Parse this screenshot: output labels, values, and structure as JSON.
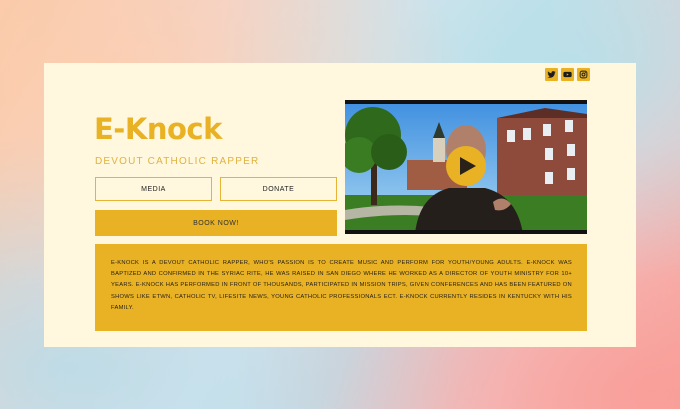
{
  "site": {
    "title": "E-Knock",
    "subtitle": "DEVOUT CATHOLIC RAPPER"
  },
  "social": {
    "icons": [
      "twitter-icon",
      "youtube-icon",
      "instagram-icon"
    ]
  },
  "buttons": {
    "media": "MEDIA",
    "donate": "DONATE",
    "book": "BOOK NOW!"
  },
  "bio": {
    "text": "E-KNOCK IS A DEVOUT CATHOLIC RAPPER, WHO'S PASSION IS TO CREATE MUSIC AND PERFORM FOR YOUTH/YOUNG ADULTS. E-KNOCK WAS BAPTIZED AND CONFIRMED IN THE SYRIAC RITE, HE WAS RAISED IN SAN DIEGO WHERE HE WORKED AS A DIRECTOR OF YOUTH MINISTRY FOR 10+ YEARS. E-KNOCK HAS PERFORMED IN FRONT OF THOUSANDS, PARTICIPATED IN MISSION TRIPS, GIVEN CONFERENCES AND HAS BEEN FEATURED ON SHOWS LIKE ETWN, CATHOLIC TV, LIFESITE NEWS, YOUNG CATHOLIC PROFESSIONALS ECT. E-KNOCK CURRENTLY RESIDES IN KENTUCKY WITH HIS FAMILY."
  },
  "colors": {
    "accent": "#e9b224",
    "card": "#fff7de"
  }
}
